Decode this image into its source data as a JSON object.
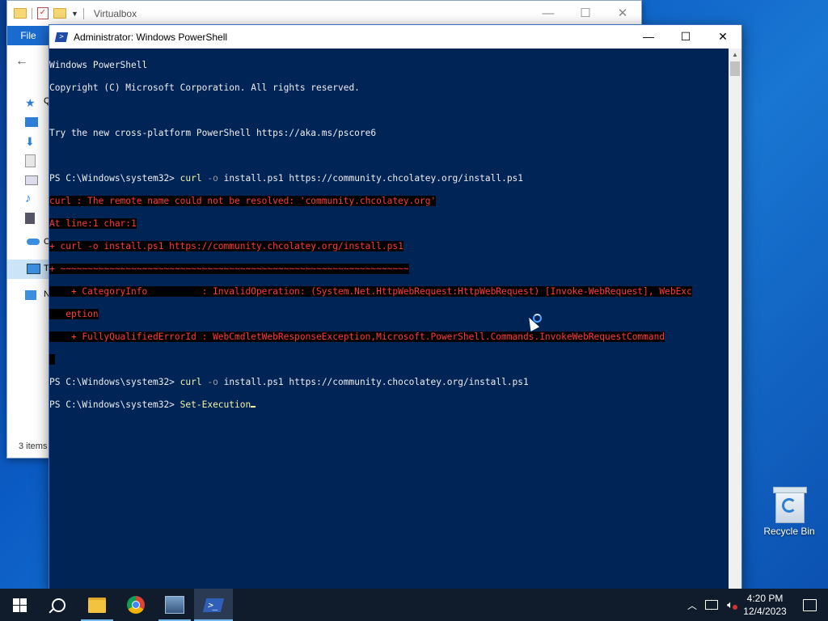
{
  "colors": {
    "console_bg": "#012456",
    "console_fg": "#eeedf0",
    "command_yellow": "#f4f4a4",
    "param_gray": "#9a9a9a",
    "error_red": "#ff3a3a",
    "taskbar": "#101c2b",
    "accent": "#76b9ed"
  },
  "explorer": {
    "title": "Virtualbox",
    "file_tab": "File",
    "status": "3 items",
    "sidebar_letters": [
      "Q",
      "O",
      "T",
      "N"
    ]
  },
  "powershell": {
    "title": "Administrator: Windows PowerShell",
    "lines": {
      "l1": "Windows PowerShell",
      "l2": "Copyright (C) Microsoft Corporation. All rights reserved.",
      "l4": "Try the new cross-platform PowerShell https://aka.ms/pscore6",
      "prompt": "PS C:\\Windows\\system32> ",
      "cmd1_name": "curl",
      "cmd1_flag": "-o",
      "cmd1_args": " install.ps1 https://community.chcolatey.org/install.ps1",
      "err1": "curl : The remote name could not be resolved: 'community.chcolatey.org'",
      "err2": "At line:1 char:1",
      "err3": "+ curl -o install.ps1 https://community.chcolatey.org/install.ps1",
      "err4": "+ ~~~~~~~~~~~~~~~~~~~~~~~~~~~~~~~~~~~~~~~~~~~~~~~~~~~~~~~~~~~~~~~~",
      "err5": "    + CategoryInfo          : InvalidOperation: (System.Net.HttpWebRequest:HttpWebRequest) [Invoke-WebRequest], WebExc",
      "err6": "   eption",
      "err7": "    + FullyQualifiedErrorId : WebCmdletWebResponseException,Microsoft.PowerShell.Commands.InvokeWebRequestCommand",
      "cmd2_name": "curl",
      "cmd2_flag": "-o",
      "cmd2_args": " install.ps1 https://community.chocolatey.org/install.ps1",
      "cmd3_partial": "Set-Execution"
    }
  },
  "desktop": {
    "recycle_bin": "Recycle Bin"
  },
  "taskbar": {
    "apps": [
      "start-button",
      "search-button",
      "file-explorer",
      "chrome",
      "installer",
      "powershell"
    ],
    "time": "4:20 PM",
    "date": "12/4/2023"
  }
}
